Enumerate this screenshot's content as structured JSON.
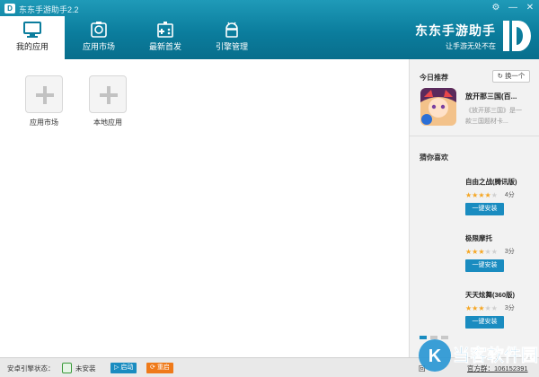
{
  "app": {
    "title": "东东手游助手2.2"
  },
  "tabs": [
    {
      "label": "我的应用",
      "icon": "monitor-icon",
      "active": true
    },
    {
      "label": "应用市场",
      "icon": "camera-icon"
    },
    {
      "label": "最新首发",
      "icon": "gamepad-icon"
    },
    {
      "label": "引擎管理",
      "icon": "android-icon"
    }
  ],
  "brand": {
    "name": "东东手游助手",
    "slogan": "让手游无处不在"
  },
  "window_controls": {
    "settings": "⚙",
    "minimize": "—",
    "close": "✕"
  },
  "main": {
    "tiles": [
      {
        "label": "应用市场"
      },
      {
        "label": "本地应用"
      }
    ]
  },
  "sidebar": {
    "today_title": "今日推荐",
    "swap_label": "换一个",
    "recommend": {
      "name": "放开那三国(百...",
      "desc1": "《放开那三国》是一",
      "desc2": "款三国题材卡..."
    },
    "guess_title": "猜你喜欢",
    "games": [
      {
        "name": "自由之战(腾讯版)",
        "stars": 4,
        "score": "4分",
        "btn": "一键安装"
      },
      {
        "name": "极限摩托",
        "stars": 3,
        "score": "3分",
        "btn": "一键安装"
      },
      {
        "name": "天天炫舞(360版)",
        "stars": 3,
        "score": "3分",
        "btn": "一键安装"
      }
    ]
  },
  "status": {
    "engine_label": "安卓引擎状态：",
    "engine_state": "未安装",
    "start_btn": "启动",
    "restart_btn": "重启",
    "back_label": "回",
    "qq_group": "官方群：106152391"
  },
  "watermark": {
    "text": "当客软件园",
    "logo_letter": "K"
  },
  "colors": {
    "primary": "#0b7d9d",
    "accent": "#1a8cc0",
    "star": "#f5a623",
    "restart": "#ef7a1a"
  }
}
